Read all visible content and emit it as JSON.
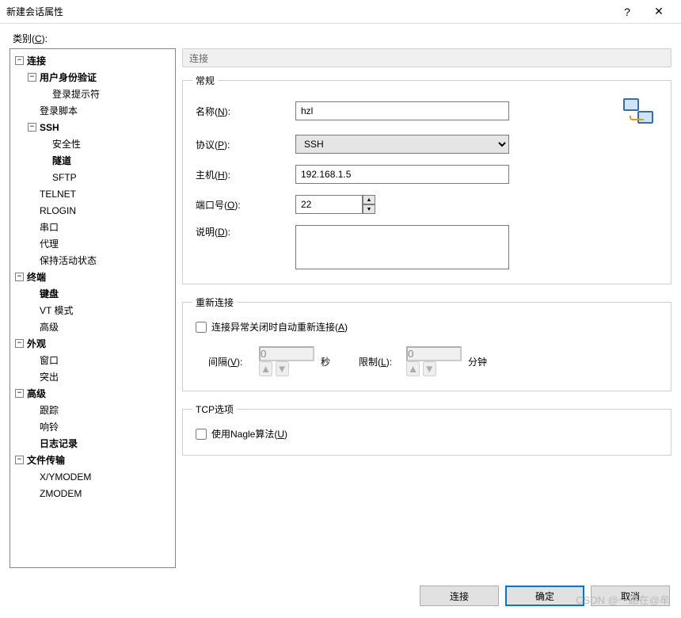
{
  "window": {
    "title": "新建会话属性",
    "help": "?",
    "close": "✕"
  },
  "category_label": "类别(C):",
  "tree": [
    {
      "level": 0,
      "exp": "-",
      "label": "连接",
      "bold": true
    },
    {
      "level": 1,
      "exp": "-",
      "label": "用户身份验证",
      "bold": true
    },
    {
      "level": 2,
      "exp": "",
      "label": "登录提示符"
    },
    {
      "level": 1,
      "exp": "",
      "label": "登录脚本"
    },
    {
      "level": 1,
      "exp": "-",
      "label": "SSH",
      "bold": true
    },
    {
      "level": 2,
      "exp": "",
      "label": "安全性"
    },
    {
      "level": 2,
      "exp": "",
      "label": "隧道",
      "bold": true,
      "selected": false
    },
    {
      "level": 2,
      "exp": "",
      "label": "SFTP"
    },
    {
      "level": 1,
      "exp": "",
      "label": "TELNET"
    },
    {
      "level": 1,
      "exp": "",
      "label": "RLOGIN"
    },
    {
      "level": 1,
      "exp": "",
      "label": "串口"
    },
    {
      "level": 1,
      "exp": "",
      "label": "代理"
    },
    {
      "level": 1,
      "exp": "",
      "label": "保持活动状态"
    },
    {
      "level": 0,
      "exp": "-",
      "label": "终端",
      "bold": true
    },
    {
      "level": 1,
      "exp": "",
      "label": "键盘",
      "bold": true
    },
    {
      "level": 1,
      "exp": "",
      "label": "VT 模式"
    },
    {
      "level": 1,
      "exp": "",
      "label": "高级"
    },
    {
      "level": 0,
      "exp": "-",
      "label": "外观",
      "bold": true
    },
    {
      "level": 1,
      "exp": "",
      "label": "窗口"
    },
    {
      "level": 1,
      "exp": "",
      "label": "突出"
    },
    {
      "level": 0,
      "exp": "-",
      "label": "高级",
      "bold": true
    },
    {
      "level": 1,
      "exp": "",
      "label": "跟踪"
    },
    {
      "level": 1,
      "exp": "",
      "label": "响铃"
    },
    {
      "level": 1,
      "exp": "",
      "label": "日志记录",
      "bold": true
    },
    {
      "level": 0,
      "exp": "-",
      "label": "文件传输",
      "bold": true
    },
    {
      "level": 1,
      "exp": "",
      "label": "X/YMODEM"
    },
    {
      "level": 1,
      "exp": "",
      "label": "ZMODEM"
    }
  ],
  "panel_title": "连接",
  "general": {
    "legend": "常规",
    "name_label": "名称(N):",
    "name_value": "hzl",
    "proto_label": "协议(P):",
    "proto_value": "SSH",
    "host_label": "主机(H):",
    "host_value": "192.168.1.5",
    "port_label": "端口号(O):",
    "port_value": "22",
    "desc_label": "说明(D):",
    "desc_value": ""
  },
  "reconnect": {
    "legend": "重新连接",
    "auto_label": "连接异常关闭时自动重新连接(A)",
    "interval_label": "间隔(V):",
    "interval_value": "0",
    "interval_unit": "秒",
    "limit_label": "限制(L):",
    "limit_value": "0",
    "limit_unit": "分钟"
  },
  "tcp": {
    "legend": "TCP选项",
    "nagle_label": "使用Nagle算法(U)"
  },
  "footer": {
    "connect": "连接",
    "ok": "确定",
    "cancel": "取消"
  },
  "watermark": "CSDN @一路在@牟"
}
